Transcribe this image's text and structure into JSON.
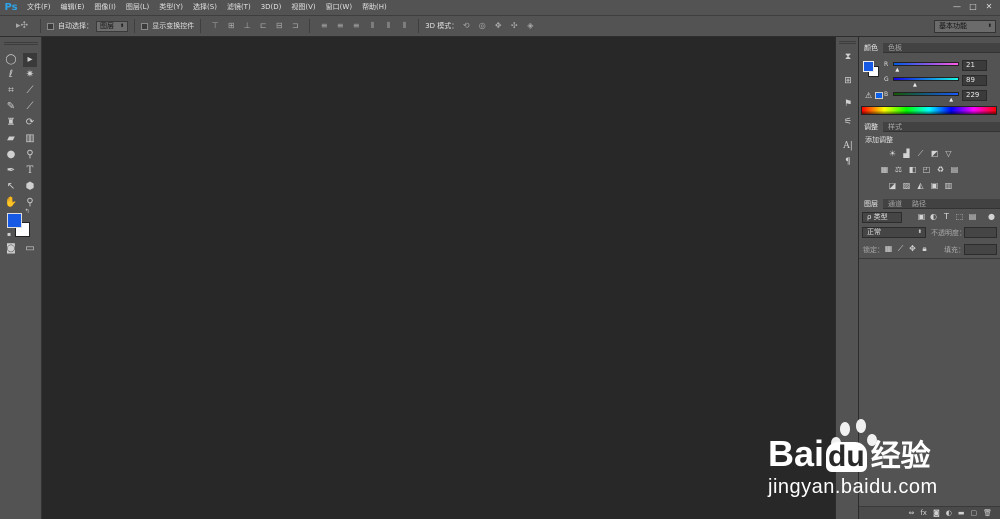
{
  "app": {
    "logo": "Ps"
  },
  "menu": [
    "文件(F)",
    "编辑(E)",
    "图像(I)",
    "图层(L)",
    "类型(Y)",
    "选择(S)",
    "滤镜(T)",
    "3D(D)",
    "视图(V)",
    "窗口(W)",
    "帮助(H)"
  ],
  "window_controls": [
    "—",
    "□",
    "✕"
  ],
  "options": {
    "auto_select_label": "自动选择：",
    "auto_select_value": "图层",
    "show_transform_label": "显示变换控件",
    "mode_3d_label": "3D 模式：",
    "workspace": "基本功能"
  },
  "color_panel": {
    "tabs": [
      "颜色",
      "色板"
    ],
    "channels": [
      {
        "name": "R",
        "value": "21",
        "fraction": 0.082
      },
      {
        "name": "G",
        "value": "89",
        "fraction": 0.349
      },
      {
        "name": "B",
        "value": "229",
        "fraction": 0.898
      }
    ],
    "foreground": "#1559e5",
    "background": "#ffffff"
  },
  "adjust_panel": {
    "tabs": [
      "调整",
      "样式"
    ],
    "title": "添加调整"
  },
  "layers_panel": {
    "tabs": [
      "图层",
      "通道",
      "路径"
    ],
    "filter": "ρ 类型",
    "blend_mode": "正常",
    "opacity_label": "不透明度：",
    "lock_label": "锁定：",
    "fill_label": "填充："
  },
  "watermark": {
    "brand_a": "Bai",
    "brand_b": "du",
    "brand_cn": "经验",
    "url": "jingyan.baidu.com"
  }
}
